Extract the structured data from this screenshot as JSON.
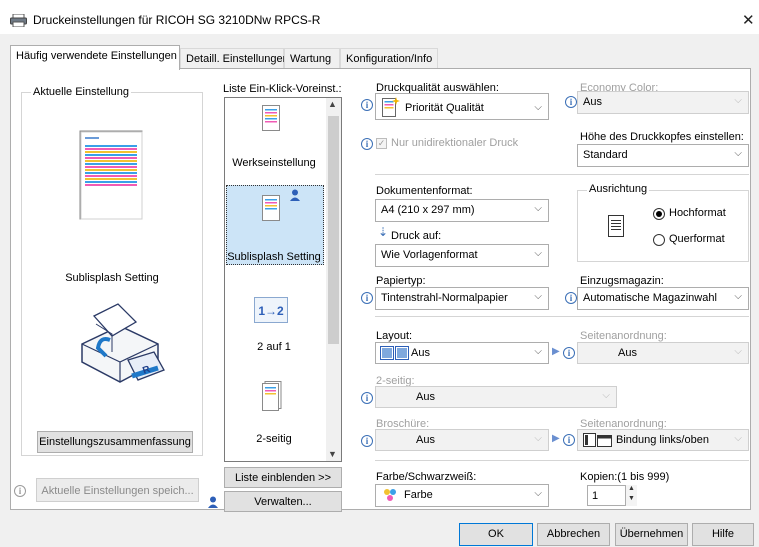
{
  "window": {
    "title": "Druckeinstellungen für RICOH SG 3210DNw RPCS-R",
    "close_glyph": "✕"
  },
  "tabs": [
    {
      "label": "Häufig verwendete Einstellungen",
      "active": true
    },
    {
      "label": "Detaill. Einstellungen"
    },
    {
      "label": "Wartung"
    },
    {
      "label": "Konfiguration/Info"
    }
  ],
  "current": {
    "legend": "Aktuelle Einstellung",
    "preset_name": "Sublisplash Setting",
    "summary_button": "Einstellungszusammenfassung",
    "save_button": "Aktuelle Einstellungen speich..."
  },
  "oneclick": {
    "legend": "Liste Ein-Klick-Voreinst.:",
    "items": [
      {
        "label": "Werkseinstellung"
      },
      {
        "label": "Sublisplash Setting",
        "selected": true
      },
      {
        "label": "2 auf 1",
        "icon_text": "1→2"
      },
      {
        "label": "2-seitig"
      }
    ],
    "show_list_button": "Liste einblenden >>",
    "manage_button": "Verwalten..."
  },
  "settings": {
    "quality_label": "Druckqualität auswählen:",
    "quality_value": "Priorität Qualität",
    "economy_label": "Economy Color:",
    "economy_value": "Aus",
    "unidirectional_label": "Nur unidirektionaler Druck",
    "head_height_label": "Höhe des Druckkopfes einstellen:",
    "head_height_value": "Standard",
    "doc_format_label": "Dokumentenformat:",
    "doc_format_value": "A4 (210 x 297 mm)",
    "print_on_label": "Druck auf:",
    "print_on_value": "Wie Vorlagenformat",
    "orientation_legend": "Ausrichtung",
    "orientation_portrait": "Hochformat",
    "orientation_landscape": "Querformat",
    "paper_type_label": "Papiertyp:",
    "paper_type_value": "Tintenstrahl-Normalpapier",
    "tray_label": "Einzugsmagazin:",
    "tray_value": "Automatische Magazinwahl",
    "layout_label": "Layout:",
    "layout_value": "Aus",
    "page_order_label": "Seitenanordnung:",
    "page_order_value": "Aus",
    "duplex_label": "2-seitig:",
    "duplex_value": "Aus",
    "booklet_label": "Broschüre:",
    "booklet_value": "Aus",
    "page_order2_label": "Seitenanordnung:",
    "page_order2_value": "Bindung links/oben",
    "color_label": "Farbe/Schwarzweiß:",
    "color_value": "Farbe",
    "copies_label": "Kopien:(1 bis 999)",
    "copies_value": "1"
  },
  "footer": {
    "ok": "OK",
    "cancel": "Abbrechen",
    "apply": "Übernehmen",
    "help": "Hilfe"
  },
  "icons": {
    "info": "i",
    "dropdown": "chevron-down-icon",
    "play": "▶"
  }
}
